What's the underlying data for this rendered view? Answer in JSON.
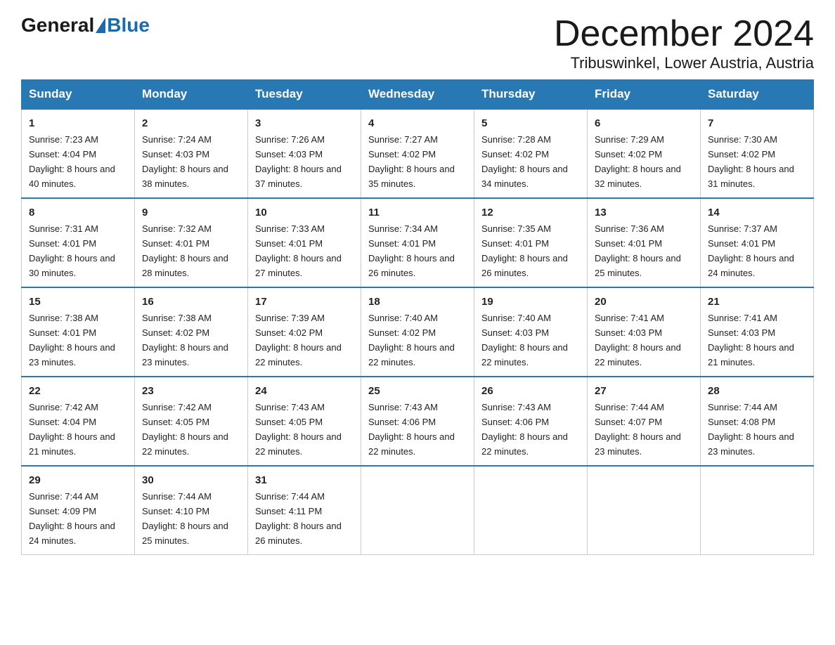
{
  "logo": {
    "general": "General",
    "blue": "Blue"
  },
  "header": {
    "month_year": "December 2024",
    "location": "Tribuswinkel, Lower Austria, Austria"
  },
  "days_of_week": [
    "Sunday",
    "Monday",
    "Tuesday",
    "Wednesday",
    "Thursday",
    "Friday",
    "Saturday"
  ],
  "weeks": [
    [
      {
        "day": "1",
        "sunrise": "7:23 AM",
        "sunset": "4:04 PM",
        "daylight": "8 hours and 40 minutes."
      },
      {
        "day": "2",
        "sunrise": "7:24 AM",
        "sunset": "4:03 PM",
        "daylight": "8 hours and 38 minutes."
      },
      {
        "day": "3",
        "sunrise": "7:26 AM",
        "sunset": "4:03 PM",
        "daylight": "8 hours and 37 minutes."
      },
      {
        "day": "4",
        "sunrise": "7:27 AM",
        "sunset": "4:02 PM",
        "daylight": "8 hours and 35 minutes."
      },
      {
        "day": "5",
        "sunrise": "7:28 AM",
        "sunset": "4:02 PM",
        "daylight": "8 hours and 34 minutes."
      },
      {
        "day": "6",
        "sunrise": "7:29 AM",
        "sunset": "4:02 PM",
        "daylight": "8 hours and 32 minutes."
      },
      {
        "day": "7",
        "sunrise": "7:30 AM",
        "sunset": "4:02 PM",
        "daylight": "8 hours and 31 minutes."
      }
    ],
    [
      {
        "day": "8",
        "sunrise": "7:31 AM",
        "sunset": "4:01 PM",
        "daylight": "8 hours and 30 minutes."
      },
      {
        "day": "9",
        "sunrise": "7:32 AM",
        "sunset": "4:01 PM",
        "daylight": "8 hours and 28 minutes."
      },
      {
        "day": "10",
        "sunrise": "7:33 AM",
        "sunset": "4:01 PM",
        "daylight": "8 hours and 27 minutes."
      },
      {
        "day": "11",
        "sunrise": "7:34 AM",
        "sunset": "4:01 PM",
        "daylight": "8 hours and 26 minutes."
      },
      {
        "day": "12",
        "sunrise": "7:35 AM",
        "sunset": "4:01 PM",
        "daylight": "8 hours and 26 minutes."
      },
      {
        "day": "13",
        "sunrise": "7:36 AM",
        "sunset": "4:01 PM",
        "daylight": "8 hours and 25 minutes."
      },
      {
        "day": "14",
        "sunrise": "7:37 AM",
        "sunset": "4:01 PM",
        "daylight": "8 hours and 24 minutes."
      }
    ],
    [
      {
        "day": "15",
        "sunrise": "7:38 AM",
        "sunset": "4:01 PM",
        "daylight": "8 hours and 23 minutes."
      },
      {
        "day": "16",
        "sunrise": "7:38 AM",
        "sunset": "4:02 PM",
        "daylight": "8 hours and 23 minutes."
      },
      {
        "day": "17",
        "sunrise": "7:39 AM",
        "sunset": "4:02 PM",
        "daylight": "8 hours and 22 minutes."
      },
      {
        "day": "18",
        "sunrise": "7:40 AM",
        "sunset": "4:02 PM",
        "daylight": "8 hours and 22 minutes."
      },
      {
        "day": "19",
        "sunrise": "7:40 AM",
        "sunset": "4:03 PM",
        "daylight": "8 hours and 22 minutes."
      },
      {
        "day": "20",
        "sunrise": "7:41 AM",
        "sunset": "4:03 PM",
        "daylight": "8 hours and 22 minutes."
      },
      {
        "day": "21",
        "sunrise": "7:41 AM",
        "sunset": "4:03 PM",
        "daylight": "8 hours and 21 minutes."
      }
    ],
    [
      {
        "day": "22",
        "sunrise": "7:42 AM",
        "sunset": "4:04 PM",
        "daylight": "8 hours and 21 minutes."
      },
      {
        "day": "23",
        "sunrise": "7:42 AM",
        "sunset": "4:05 PM",
        "daylight": "8 hours and 22 minutes."
      },
      {
        "day": "24",
        "sunrise": "7:43 AM",
        "sunset": "4:05 PM",
        "daylight": "8 hours and 22 minutes."
      },
      {
        "day": "25",
        "sunrise": "7:43 AM",
        "sunset": "4:06 PM",
        "daylight": "8 hours and 22 minutes."
      },
      {
        "day": "26",
        "sunrise": "7:43 AM",
        "sunset": "4:06 PM",
        "daylight": "8 hours and 22 minutes."
      },
      {
        "day": "27",
        "sunrise": "7:44 AM",
        "sunset": "4:07 PM",
        "daylight": "8 hours and 23 minutes."
      },
      {
        "day": "28",
        "sunrise": "7:44 AM",
        "sunset": "4:08 PM",
        "daylight": "8 hours and 23 minutes."
      }
    ],
    [
      {
        "day": "29",
        "sunrise": "7:44 AM",
        "sunset": "4:09 PM",
        "daylight": "8 hours and 24 minutes."
      },
      {
        "day": "30",
        "sunrise": "7:44 AM",
        "sunset": "4:10 PM",
        "daylight": "8 hours and 25 minutes."
      },
      {
        "day": "31",
        "sunrise": "7:44 AM",
        "sunset": "4:11 PM",
        "daylight": "8 hours and 26 minutes."
      },
      null,
      null,
      null,
      null
    ]
  ]
}
